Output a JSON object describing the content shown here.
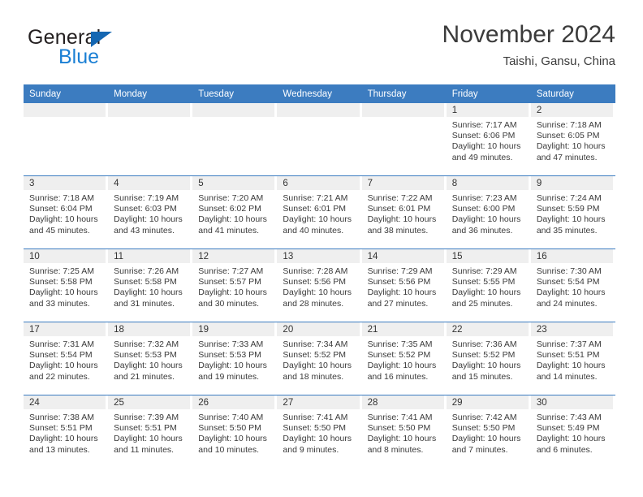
{
  "brand": {
    "name_part1": "General",
    "name_part2": "Blue",
    "triangle_color": "#1567b2",
    "blue_color": "#1a7fd4"
  },
  "header": {
    "title": "November 2024",
    "subtitle": "Taishi, Gansu, China"
  },
  "theme": {
    "header_row_bg": "#3c7cc0",
    "daynum_band_bg": "#efefef",
    "row_separator": "#3c7cc0",
    "text": "#3a3a3a"
  },
  "weekday_headers": [
    "Sunday",
    "Monday",
    "Tuesday",
    "Wednesday",
    "Thursday",
    "Friday",
    "Saturday"
  ],
  "labels": {
    "sunrise_prefix": "Sunrise:",
    "sunset_prefix": "Sunset:",
    "daylight_prefix": "Daylight:"
  },
  "weeks": [
    [
      {
        "day": "",
        "empty": true
      },
      {
        "day": "",
        "empty": true
      },
      {
        "day": "",
        "empty": true
      },
      {
        "day": "",
        "empty": true
      },
      {
        "day": "",
        "empty": true
      },
      {
        "day": "1",
        "sunrise": "Sunrise: 7:17 AM",
        "sunset": "Sunset: 6:06 PM",
        "daylight_line1": "Daylight: 10 hours",
        "daylight_line2": "and 49 minutes."
      },
      {
        "day": "2",
        "sunrise": "Sunrise: 7:18 AM",
        "sunset": "Sunset: 6:05 PM",
        "daylight_line1": "Daylight: 10 hours",
        "daylight_line2": "and 47 minutes."
      }
    ],
    [
      {
        "day": "3",
        "sunrise": "Sunrise: 7:18 AM",
        "sunset": "Sunset: 6:04 PM",
        "daylight_line1": "Daylight: 10 hours",
        "daylight_line2": "and 45 minutes."
      },
      {
        "day": "4",
        "sunrise": "Sunrise: 7:19 AM",
        "sunset": "Sunset: 6:03 PM",
        "daylight_line1": "Daylight: 10 hours",
        "daylight_line2": "and 43 minutes."
      },
      {
        "day": "5",
        "sunrise": "Sunrise: 7:20 AM",
        "sunset": "Sunset: 6:02 PM",
        "daylight_line1": "Daylight: 10 hours",
        "daylight_line2": "and 41 minutes."
      },
      {
        "day": "6",
        "sunrise": "Sunrise: 7:21 AM",
        "sunset": "Sunset: 6:01 PM",
        "daylight_line1": "Daylight: 10 hours",
        "daylight_line2": "and 40 minutes."
      },
      {
        "day": "7",
        "sunrise": "Sunrise: 7:22 AM",
        "sunset": "Sunset: 6:01 PM",
        "daylight_line1": "Daylight: 10 hours",
        "daylight_line2": "and 38 minutes."
      },
      {
        "day": "8",
        "sunrise": "Sunrise: 7:23 AM",
        "sunset": "Sunset: 6:00 PM",
        "daylight_line1": "Daylight: 10 hours",
        "daylight_line2": "and 36 minutes."
      },
      {
        "day": "9",
        "sunrise": "Sunrise: 7:24 AM",
        "sunset": "Sunset: 5:59 PM",
        "daylight_line1": "Daylight: 10 hours",
        "daylight_line2": "and 35 minutes."
      }
    ],
    [
      {
        "day": "10",
        "sunrise": "Sunrise: 7:25 AM",
        "sunset": "Sunset: 5:58 PM",
        "daylight_line1": "Daylight: 10 hours",
        "daylight_line2": "and 33 minutes."
      },
      {
        "day": "11",
        "sunrise": "Sunrise: 7:26 AM",
        "sunset": "Sunset: 5:58 PM",
        "daylight_line1": "Daylight: 10 hours",
        "daylight_line2": "and 31 minutes."
      },
      {
        "day": "12",
        "sunrise": "Sunrise: 7:27 AM",
        "sunset": "Sunset: 5:57 PM",
        "daylight_line1": "Daylight: 10 hours",
        "daylight_line2": "and 30 minutes."
      },
      {
        "day": "13",
        "sunrise": "Sunrise: 7:28 AM",
        "sunset": "Sunset: 5:56 PM",
        "daylight_line1": "Daylight: 10 hours",
        "daylight_line2": "and 28 minutes."
      },
      {
        "day": "14",
        "sunrise": "Sunrise: 7:29 AM",
        "sunset": "Sunset: 5:56 PM",
        "daylight_line1": "Daylight: 10 hours",
        "daylight_line2": "and 27 minutes."
      },
      {
        "day": "15",
        "sunrise": "Sunrise: 7:29 AM",
        "sunset": "Sunset: 5:55 PM",
        "daylight_line1": "Daylight: 10 hours",
        "daylight_line2": "and 25 minutes."
      },
      {
        "day": "16",
        "sunrise": "Sunrise: 7:30 AM",
        "sunset": "Sunset: 5:54 PM",
        "daylight_line1": "Daylight: 10 hours",
        "daylight_line2": "and 24 minutes."
      }
    ],
    [
      {
        "day": "17",
        "sunrise": "Sunrise: 7:31 AM",
        "sunset": "Sunset: 5:54 PM",
        "daylight_line1": "Daylight: 10 hours",
        "daylight_line2": "and 22 minutes."
      },
      {
        "day": "18",
        "sunrise": "Sunrise: 7:32 AM",
        "sunset": "Sunset: 5:53 PM",
        "daylight_line1": "Daylight: 10 hours",
        "daylight_line2": "and 21 minutes."
      },
      {
        "day": "19",
        "sunrise": "Sunrise: 7:33 AM",
        "sunset": "Sunset: 5:53 PM",
        "daylight_line1": "Daylight: 10 hours",
        "daylight_line2": "and 19 minutes."
      },
      {
        "day": "20",
        "sunrise": "Sunrise: 7:34 AM",
        "sunset": "Sunset: 5:52 PM",
        "daylight_line1": "Daylight: 10 hours",
        "daylight_line2": "and 18 minutes."
      },
      {
        "day": "21",
        "sunrise": "Sunrise: 7:35 AM",
        "sunset": "Sunset: 5:52 PM",
        "daylight_line1": "Daylight: 10 hours",
        "daylight_line2": "and 16 minutes."
      },
      {
        "day": "22",
        "sunrise": "Sunrise: 7:36 AM",
        "sunset": "Sunset: 5:52 PM",
        "daylight_line1": "Daylight: 10 hours",
        "daylight_line2": "and 15 minutes."
      },
      {
        "day": "23",
        "sunrise": "Sunrise: 7:37 AM",
        "sunset": "Sunset: 5:51 PM",
        "daylight_line1": "Daylight: 10 hours",
        "daylight_line2": "and 14 minutes."
      }
    ],
    [
      {
        "day": "24",
        "sunrise": "Sunrise: 7:38 AM",
        "sunset": "Sunset: 5:51 PM",
        "daylight_line1": "Daylight: 10 hours",
        "daylight_line2": "and 13 minutes."
      },
      {
        "day": "25",
        "sunrise": "Sunrise: 7:39 AM",
        "sunset": "Sunset: 5:51 PM",
        "daylight_line1": "Daylight: 10 hours",
        "daylight_line2": "and 11 minutes."
      },
      {
        "day": "26",
        "sunrise": "Sunrise: 7:40 AM",
        "sunset": "Sunset: 5:50 PM",
        "daylight_line1": "Daylight: 10 hours",
        "daylight_line2": "and 10 minutes."
      },
      {
        "day": "27",
        "sunrise": "Sunrise: 7:41 AM",
        "sunset": "Sunset: 5:50 PM",
        "daylight_line1": "Daylight: 10 hours",
        "daylight_line2": "and 9 minutes."
      },
      {
        "day": "28",
        "sunrise": "Sunrise: 7:41 AM",
        "sunset": "Sunset: 5:50 PM",
        "daylight_line1": "Daylight: 10 hours",
        "daylight_line2": "and 8 minutes."
      },
      {
        "day": "29",
        "sunrise": "Sunrise: 7:42 AM",
        "sunset": "Sunset: 5:50 PM",
        "daylight_line1": "Daylight: 10 hours",
        "daylight_line2": "and 7 minutes."
      },
      {
        "day": "30",
        "sunrise": "Sunrise: 7:43 AM",
        "sunset": "Sunset: 5:49 PM",
        "daylight_line1": "Daylight: 10 hours",
        "daylight_line2": "and 6 minutes."
      }
    ]
  ]
}
